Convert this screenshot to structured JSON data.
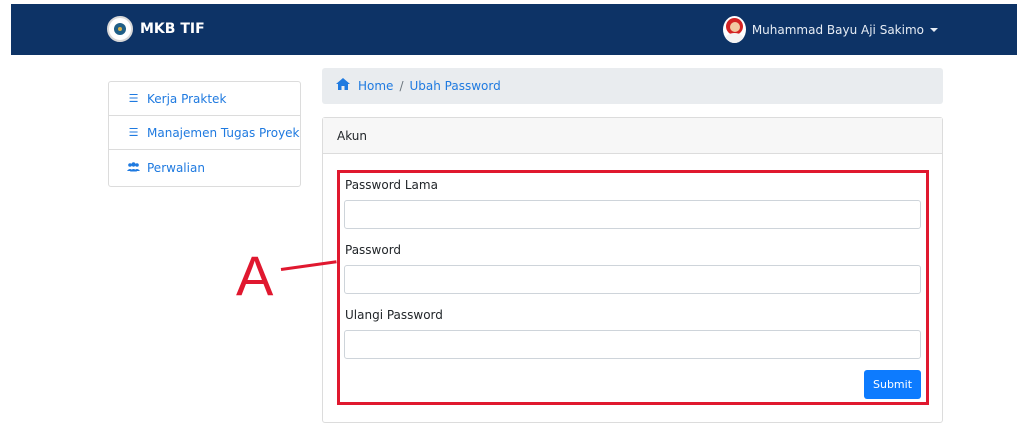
{
  "navbar": {
    "brand": "MKB TIF",
    "user_name": "Muhammad Bayu Aji Sakimo"
  },
  "sidebar": {
    "items": [
      {
        "label": "Kerja Praktek",
        "icon": "tasks-icon"
      },
      {
        "label": "Manajemen Tugas Proyek",
        "icon": "tasks-icon"
      },
      {
        "label": "Perwalian",
        "icon": "users-icon"
      }
    ]
  },
  "breadcrumb": {
    "home": "Home",
    "current": "Ubah Password"
  },
  "card": {
    "title": "Akun",
    "fields": [
      {
        "label": "Password Lama",
        "value": ""
      },
      {
        "label": "Password",
        "value": ""
      },
      {
        "label": "Ulangi Password",
        "value": ""
      }
    ],
    "submit_label": "Submit"
  },
  "annotation": {
    "letter": "A",
    "color": "#e0182f"
  },
  "colors": {
    "navbar": "#0d3366",
    "link": "#1f7ae0",
    "primary_button": "#0d7bfe"
  }
}
